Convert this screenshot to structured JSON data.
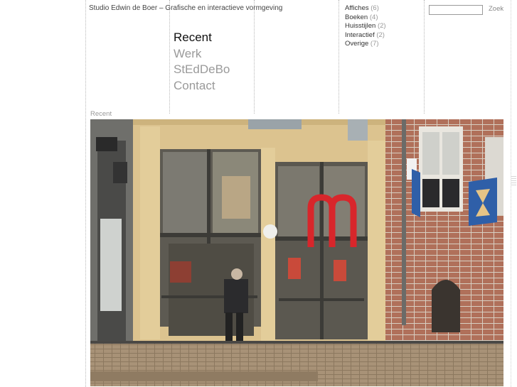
{
  "site": {
    "title": "Studio Edwin de Boer – Grafische en interactieve vormgeving"
  },
  "nav": {
    "items": [
      {
        "label": "Recent",
        "active": true
      },
      {
        "label": "Werk",
        "active": false
      },
      {
        "label": "StEdDeBo",
        "active": false
      },
      {
        "label": "Contact",
        "active": false
      }
    ]
  },
  "categories": [
    {
      "label": "Affiches",
      "count": "(6)"
    },
    {
      "label": "Boeken",
      "count": "(4)"
    },
    {
      "label": "Huisstijlen",
      "count": "(2)"
    },
    {
      "label": "Interactief",
      "count": "(2)"
    },
    {
      "label": "Overige",
      "count": "(7)"
    }
  ],
  "search": {
    "value": "",
    "button_label": "Zoek"
  },
  "content": {
    "section_label": "Recent"
  },
  "colors": {
    "nav_active": "#111111",
    "nav_inactive": "#9a9a9a",
    "storefront_logo_red": "#d8262b"
  }
}
